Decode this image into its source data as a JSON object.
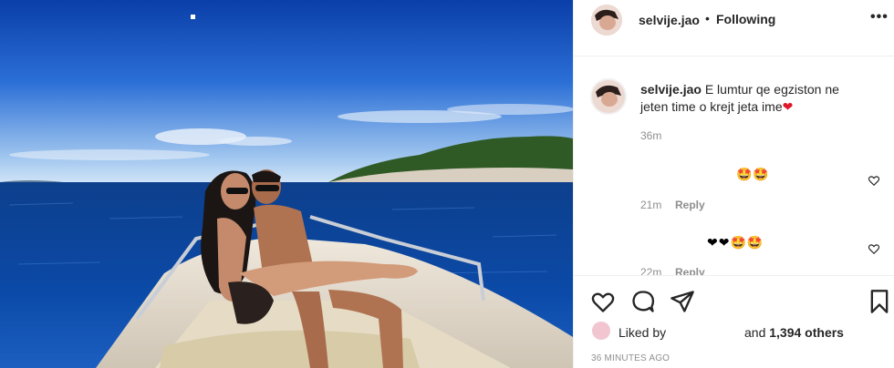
{
  "post": {
    "username": "selvije.jao",
    "follow_separator": "•",
    "follow_status": "Following",
    "more_icon": "more-icon"
  },
  "caption": {
    "username": "selvije.jao",
    "text": "E lumtur qe egziston ne jeten time o krejt jeta ime",
    "emoji": "❤",
    "time": "36m"
  },
  "comments": [
    {
      "emojis": "🤩🤩",
      "time": "21m",
      "reply_label": "Reply"
    },
    {
      "emojis": "❤❤🤩🤩",
      "time": "22m",
      "reply_label": "Reply"
    }
  ],
  "likes": {
    "liked_by_label": "Liked by",
    "and_label": "and",
    "count": "1,394 others"
  },
  "timestamp": "36 MINUTES AGO",
  "colors": {
    "accent_red": "#e0162b",
    "text_primary": "#262626",
    "text_secondary": "#8e8e8e",
    "border": "#efefef"
  }
}
